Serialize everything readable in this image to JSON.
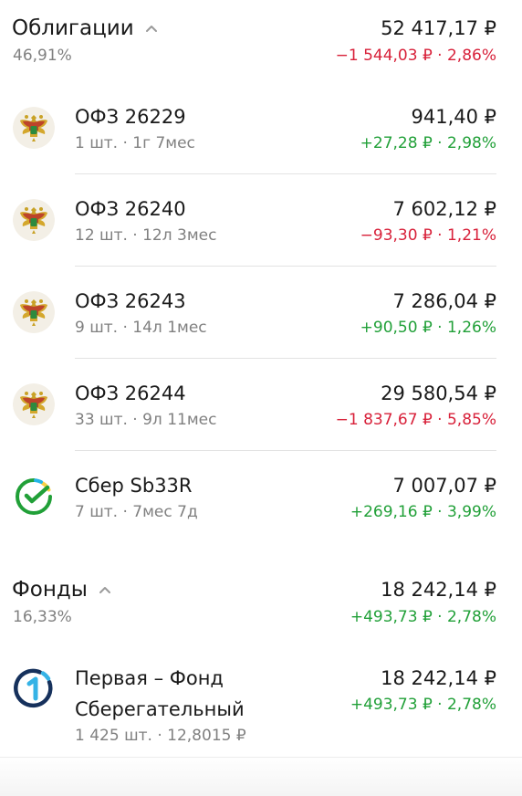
{
  "colors": {
    "negative": "#d8213a",
    "positive": "#21a038",
    "secondary": "#808080"
  },
  "sections": {
    "bonds": {
      "title": "Облигации",
      "percent": "46,91%",
      "value": "52 417,17 ₽",
      "change": "−1 544,03 ₽ · 2,86%",
      "change_sign": "negative",
      "items": [
        {
          "name": "ОФЗ 26229",
          "details": "1 шт. · 1г 7мес",
          "value": "941,40 ₽",
          "change": "+27,28 ₽ · 2,98%",
          "change_sign": "positive",
          "icon": "russian-emblem-icon"
        },
        {
          "name": "ОФЗ 26240",
          "details": "12 шт. · 12л 3мес",
          "value": "7 602,12 ₽",
          "change": "−93,30 ₽ · 1,21%",
          "change_sign": "negative",
          "icon": "russian-emblem-icon"
        },
        {
          "name": "ОФЗ 26243",
          "details": "9 шт. · 14л 1мес",
          "value": "7 286,04 ₽",
          "change": "+90,50 ₽ · 1,26%",
          "change_sign": "positive",
          "icon": "russian-emblem-icon"
        },
        {
          "name": "ОФЗ 26244",
          "details": "33 шт. · 9л 11мес",
          "value": "29 580,54 ₽",
          "change": "−1 837,67 ₽ · 5,85%",
          "change_sign": "negative",
          "icon": "russian-emblem-icon"
        },
        {
          "name": "Сбер Sb33R",
          "details": "7 шт. · 7мес 7д",
          "value": "7 007,07 ₽",
          "change": "+269,16 ₽ · 3,99%",
          "change_sign": "positive",
          "icon": "sber-logo-icon"
        }
      ]
    },
    "funds": {
      "title": "Фонды",
      "percent": "16,33%",
      "value": "18 242,14 ₽",
      "change": "+493,73 ₽ · 2,78%",
      "change_sign": "positive",
      "items": [
        {
          "name_line1": "Первая – Фонд",
          "name_line2": "Сберегательный",
          "details": "1 425 шт. · 12,8015 ₽",
          "value": "18 242,14 ₽",
          "change": "+493,73 ₽ · 2,78%",
          "change_sign": "positive",
          "icon": "pervaya-logo-icon"
        }
      ]
    }
  }
}
